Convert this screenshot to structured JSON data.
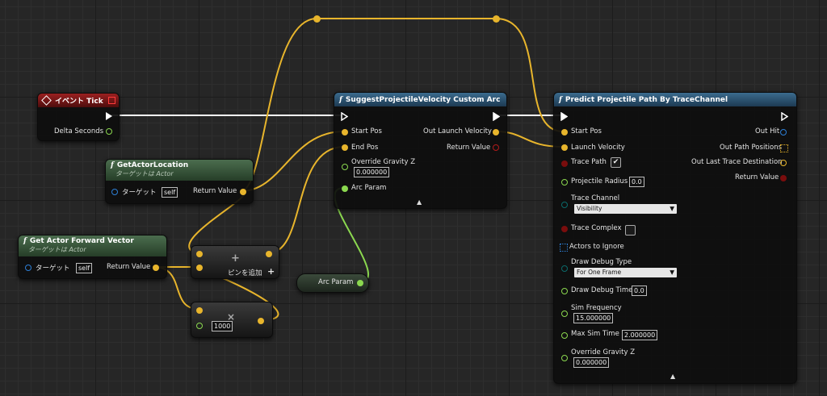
{
  "colors": {
    "vector_pin": "#e8b52c",
    "float_pin": "#8bd84f",
    "bool_pin": "#7a0d0d",
    "object_pin": "#2d7fd6",
    "struct_pin": "#0b5a5a",
    "exec_wire": "#ffffff",
    "arcparam_wire": "#8bd84f"
  },
  "event_tick": {
    "title": "イベント Tick",
    "delta_seconds": "Delta Seconds"
  },
  "get_actor_location": {
    "title": "GetActorLocation",
    "subtitle": "ターゲットは Actor",
    "target_label": "ターゲット",
    "target_value": "self",
    "return_label": "Return Value"
  },
  "get_forward_vector": {
    "title": "Get Actor Forward Vector",
    "subtitle": "ターゲットは Actor",
    "target_label": "ターゲット",
    "target_value": "self",
    "return_label": "Return Value"
  },
  "add_node": {
    "icon": "+",
    "add_pin_label": "ピンを追加",
    "add_pin_icon": "+"
  },
  "multiply_node": {
    "icon": "×",
    "value": "1000"
  },
  "arc_param_var": {
    "label": "Arc Param"
  },
  "suggest_node": {
    "title": "SuggestProjectileVelocity Custom Arc",
    "start_pos": "Start Pos",
    "end_pos": "End Pos",
    "override_gravity": "Override Gravity Z",
    "override_gravity_value": "0.000000",
    "arc_param": "Arc Param",
    "out_launch_velocity": "Out Launch Velocity",
    "return_value": "Return Value",
    "collapse": "▲"
  },
  "predict_node": {
    "title": "Predict Projectile Path By TraceChannel",
    "start_pos": "Start Pos",
    "launch_velocity": "Launch Velocity",
    "trace_path": "Trace Path",
    "trace_path_checked": "✔",
    "projectile_radius": "Projectile Radius",
    "projectile_radius_value": "0.0",
    "trace_channel": "Trace Channel",
    "trace_channel_value": "Visibility",
    "trace_complex": "Trace Complex",
    "actors_to_ignore": "Actors to Ignore",
    "draw_debug_type": "Draw Debug Type",
    "draw_debug_type_value": "For One Frame",
    "draw_debug_time": "Draw Debug Time",
    "draw_debug_time_value": "0.0",
    "sim_frequency": "Sim Frequency",
    "sim_frequency_value": "15.000000",
    "max_sim_time": "Max Sim Time",
    "max_sim_time_value": "2.000000",
    "override_gravity": "Override Gravity Z",
    "override_gravity_value": "0.000000",
    "out_hit": "Out Hit",
    "out_path_positions": "Out Path Positions",
    "out_last_trace_destination": "Out Last Trace Destination",
    "return_value": "Return Value",
    "collapse": "▲",
    "dropdown_arrow": "▼"
  }
}
